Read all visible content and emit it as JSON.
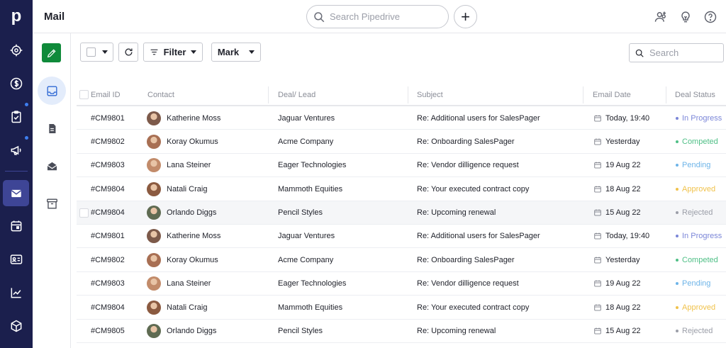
{
  "app": {
    "logo_letter": "p",
    "title": "Mail"
  },
  "search": {
    "placeholder": "Search Pipedrive"
  },
  "nav": {
    "items": [
      {
        "icon": "target-icon"
      },
      {
        "icon": "dollar-icon"
      },
      {
        "icon": "clipboard-icon"
      },
      {
        "icon": "megaphone-icon"
      },
      {
        "icon": "mail-icon"
      },
      {
        "icon": "calendar-icon"
      },
      {
        "icon": "contact-card-icon"
      },
      {
        "icon": "chart-icon"
      },
      {
        "icon": "box-icon"
      }
    ],
    "active": "mail-icon"
  },
  "toolbar": {
    "filter_label": "Filter",
    "mark_label": "Mark",
    "search_placeholder": "Search"
  },
  "table": {
    "columns": [
      "Email ID",
      "Contact",
      "Deal/ Lead",
      "Subject",
      "Email Date",
      "Deal Status"
    ],
    "rows": [
      {
        "id": "#CM9801",
        "contact": "Katherine Moss",
        "deal": "Jaguar Ventures",
        "subject": "Re: Additional users for SalesPager",
        "date": "Today, 19:40",
        "status": "In Progress",
        "status_color": "#7b86d8",
        "avatar_color": "#7d5a4a"
      },
      {
        "id": "#CM9802",
        "contact": "Koray Okumus",
        "deal": "Acme Company",
        "subject": "Re: Onboarding SalesPager",
        "date": "Yesterday",
        "status": "Competed",
        "status_color": "#4fbf86",
        "avatar_color": "#a86f53"
      },
      {
        "id": "#CM9803",
        "contact": "Lana Steiner",
        "deal": "Eager Technologies",
        "subject": "Re: Vendor dilligence request",
        "date": "19 Aug 22",
        "status": "Pending",
        "status_color": "#6db4e8",
        "avatar_color": "#c28b6a"
      },
      {
        "id": "#CM9804",
        "contact": "Natali Craig",
        "deal": "Mammoth Equities",
        "subject": "Re: Your executed contract copy",
        "date": "18 Aug 22",
        "status": "Approved",
        "status_color": "#f0c24b",
        "avatar_color": "#8b5a40"
      },
      {
        "id": "#CM9804",
        "contact": "Orlando Diggs",
        "deal": "Pencil Styles",
        "subject": "Re: Upcoming renewal",
        "date": "15 Aug 22",
        "status": "Rejected",
        "status_color": "#9b9ea8",
        "avatar_color": "#5f6b52"
      },
      {
        "id": "#CM9801",
        "contact": "Katherine Moss",
        "deal": "Jaguar Ventures",
        "subject": "Re: Additional users for SalesPager",
        "date": "Today, 19:40",
        "status": "In Progress",
        "status_color": "#7b86d8",
        "avatar_color": "#7d5a4a"
      },
      {
        "id": "#CM9802",
        "contact": "Koray Okumus",
        "deal": "Acme Company",
        "subject": "Re: Onboarding SalesPager",
        "date": "Yesterday",
        "status": "Competed",
        "status_color": "#4fbf86",
        "avatar_color": "#a86f53"
      },
      {
        "id": "#CM9803",
        "contact": "Lana Steiner",
        "deal": "Eager Technologies",
        "subject": "Re: Vendor dilligence request",
        "date": "19 Aug 22",
        "status": "Pending",
        "status_color": "#6db4e8",
        "avatar_color": "#c28b6a"
      },
      {
        "id": "#CM9804",
        "contact": "Natali Craig",
        "deal": "Mammoth Equities",
        "subject": "Re: Your executed contract copy",
        "date": "18 Aug 22",
        "status": "Approved",
        "status_color": "#f0c24b",
        "avatar_color": "#8b5a40"
      },
      {
        "id": "#CM9805",
        "contact": "Orlando Diggs",
        "deal": "Pencil Styles",
        "subject": "Re: Upcoming renewal",
        "date": "15 Aug 22",
        "status": "Rejected",
        "status_color": "#9b9ea8",
        "avatar_color": "#5f6b52"
      }
    ]
  }
}
